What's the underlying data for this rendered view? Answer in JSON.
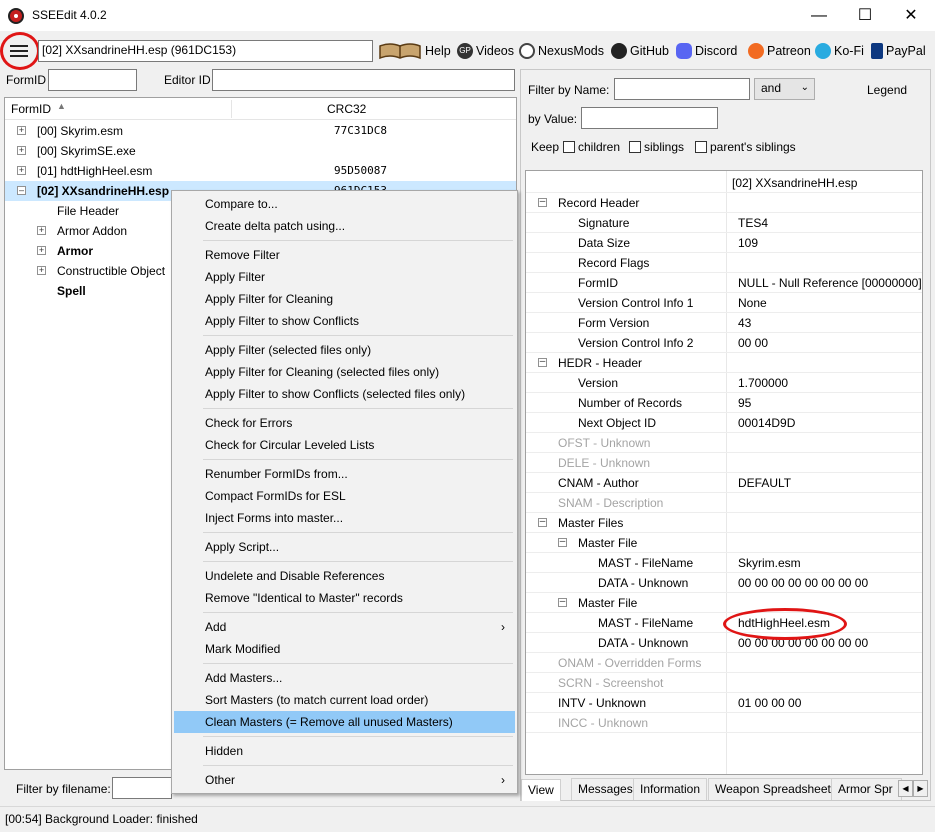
{
  "window": {
    "title": "SSEEdit 4.0.2"
  },
  "toolbar": {
    "file_field": "[02] XXsandrineHH.esp (961DC153)",
    "links": [
      {
        "label": "Help",
        "icon": "book-icon"
      },
      {
        "label": "Videos",
        "icon": "video-icon"
      },
      {
        "label": "NexusMods",
        "icon": "nexusmods-icon"
      },
      {
        "label": "GitHub",
        "icon": "github-icon"
      },
      {
        "label": "Discord",
        "icon": "discord-icon"
      },
      {
        "label": "Patreon",
        "icon": "patreon-icon"
      },
      {
        "label": "Ko-Fi",
        "icon": "kofi-icon"
      },
      {
        "label": "PayPal",
        "icon": "paypal-icon"
      }
    ]
  },
  "left": {
    "formid_label": "FormID",
    "editor_label": "Editor ID",
    "col_formid": "FormID",
    "col_crc": "CRC32",
    "rows": [
      {
        "label": "[00] Skyrim.esm",
        "crc": "77C31DC8"
      },
      {
        "label": "[00] SkyrimSE.exe",
        "crc": ""
      },
      {
        "label": "[01] hdtHighHeel.esm",
        "crc": "95D50087"
      },
      {
        "label": "[02] XXsandrineHH.esp",
        "crc": "961DC153"
      },
      {
        "label": "File Header",
        "crc": ""
      },
      {
        "label": "Armor Addon",
        "crc": ""
      },
      {
        "label": "Armor",
        "crc": ""
      },
      {
        "label": "Constructible Object",
        "crc": ""
      },
      {
        "label": "Spell",
        "crc": ""
      }
    ],
    "filter_label": "Filter by filename:"
  },
  "context_menu": {
    "items": [
      "Compare to...",
      "Create delta patch using...",
      "Remove Filter",
      "Apply Filter",
      "Apply Filter for Cleaning",
      "Apply Filter to show Conflicts",
      "Apply Filter (selected files only)",
      "Apply Filter for Cleaning (selected files only)",
      "Apply Filter to show Conflicts (selected files only)",
      "Check for Errors",
      "Check for Circular Leveled Lists",
      "Renumber FormIDs from...",
      "Compact FormIDs for ESL",
      "Inject Forms into master...",
      "Apply Script...",
      "Undelete and Disable References",
      "Remove \"Identical to Master\" records",
      "Add",
      "Mark Modified",
      "Add Masters...",
      "Sort Masters (to match current load order)",
      "Clean Masters (= Remove all unused Masters)",
      "Hidden",
      "Other"
    ],
    "submenu_arrow": "›"
  },
  "right": {
    "filter_name_label": "Filter by Name:",
    "and_select": "and",
    "legend": "Legend",
    "by_value_label": "by Value:",
    "keep_label": "Keep",
    "cb_children": "children",
    "cb_siblings": "siblings",
    "cb_parents": "parent's siblings",
    "column_header": "[02] XXsandrineHH.esp",
    "rows": [
      {
        "name": "Record Header",
        "value": ""
      },
      {
        "name": "Signature",
        "value": "TES4"
      },
      {
        "name": "Data Size",
        "value": "109"
      },
      {
        "name": "Record Flags",
        "value": ""
      },
      {
        "name": "FormID",
        "value": "NULL - Null Reference [00000000]"
      },
      {
        "name": "Version Control Info 1",
        "value": "None"
      },
      {
        "name": "Form Version",
        "value": "43"
      },
      {
        "name": "Version Control Info 2",
        "value": "00 00"
      },
      {
        "name": "HEDR - Header",
        "value": ""
      },
      {
        "name": "Version",
        "value": "1.700000"
      },
      {
        "name": "Number of Records",
        "value": "95"
      },
      {
        "name": "Next Object ID",
        "value": "00014D9D"
      },
      {
        "name": "OFST - Unknown",
        "value": ""
      },
      {
        "name": "DELE - Unknown",
        "value": ""
      },
      {
        "name": "CNAM - Author",
        "value": "DEFAULT"
      },
      {
        "name": "SNAM - Description",
        "value": ""
      },
      {
        "name": "Master Files",
        "value": ""
      },
      {
        "name": "Master File",
        "value": ""
      },
      {
        "name": "MAST - FileName",
        "value": "Skyrim.esm"
      },
      {
        "name": "DATA - Unknown",
        "value": "00 00 00 00 00 00 00 00"
      },
      {
        "name": "Master File",
        "value": ""
      },
      {
        "name": "MAST - FileName",
        "value": "hdtHighHeel.esm"
      },
      {
        "name": "DATA - Unknown",
        "value": "00 00 00 00 00 00 00 00"
      },
      {
        "name": "ONAM - Overridden Forms",
        "value": ""
      },
      {
        "name": "SCRN - Screenshot",
        "value": ""
      },
      {
        "name": "INTV - Unknown",
        "value": "01 00 00 00"
      },
      {
        "name": "INCC - Unknown",
        "value": ""
      }
    ],
    "tabs": [
      "View",
      "Messages",
      "Information",
      "Weapon Spreadsheet",
      "Armor Spr"
    ]
  },
  "status": "[00:54] Background Loader: finished",
  "colors": {
    "highlight": "#91c9f7",
    "annotation_red": "#e01515",
    "selected_row": "#cce8ff"
  }
}
